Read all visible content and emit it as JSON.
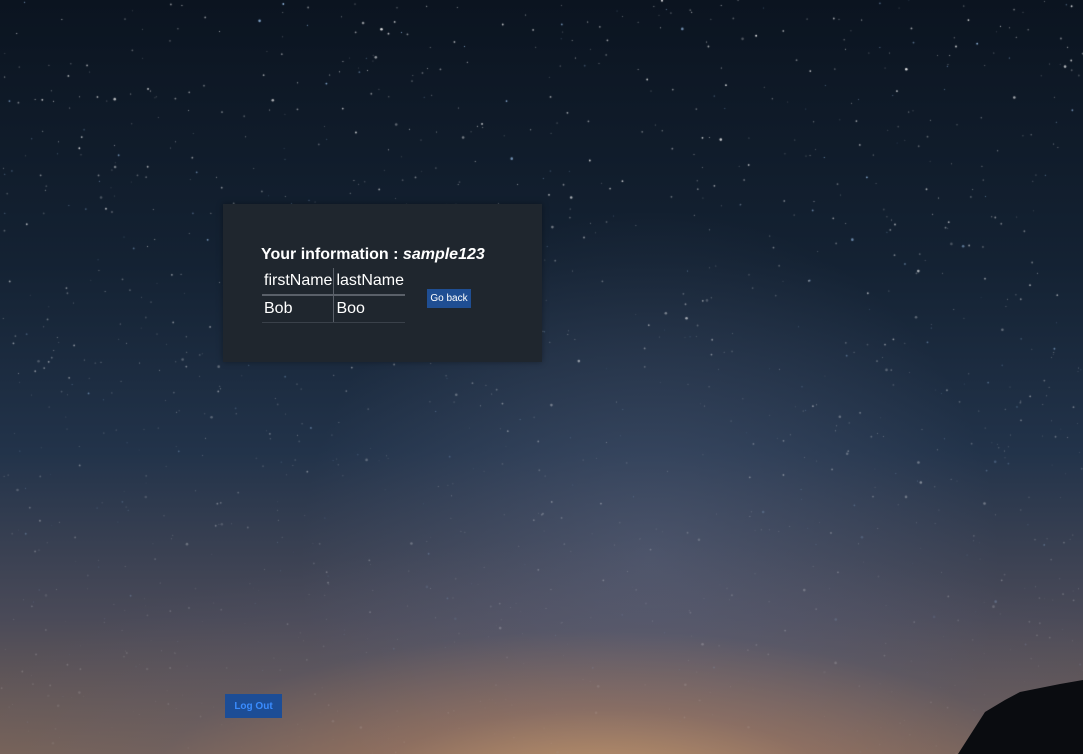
{
  "info_panel": {
    "title_prefix": "Your information :",
    "username": "sample123",
    "table": {
      "headers": [
        "firstName",
        "lastName"
      ],
      "rows": [
        [
          "Bob",
          "Boo"
        ]
      ]
    },
    "back_label": "Go back"
  },
  "logout_label": "Log Out",
  "colors": {
    "panel_bg": "#1f262e",
    "button_bg": "#1f4e93",
    "logout_text": "#3a8cff"
  }
}
